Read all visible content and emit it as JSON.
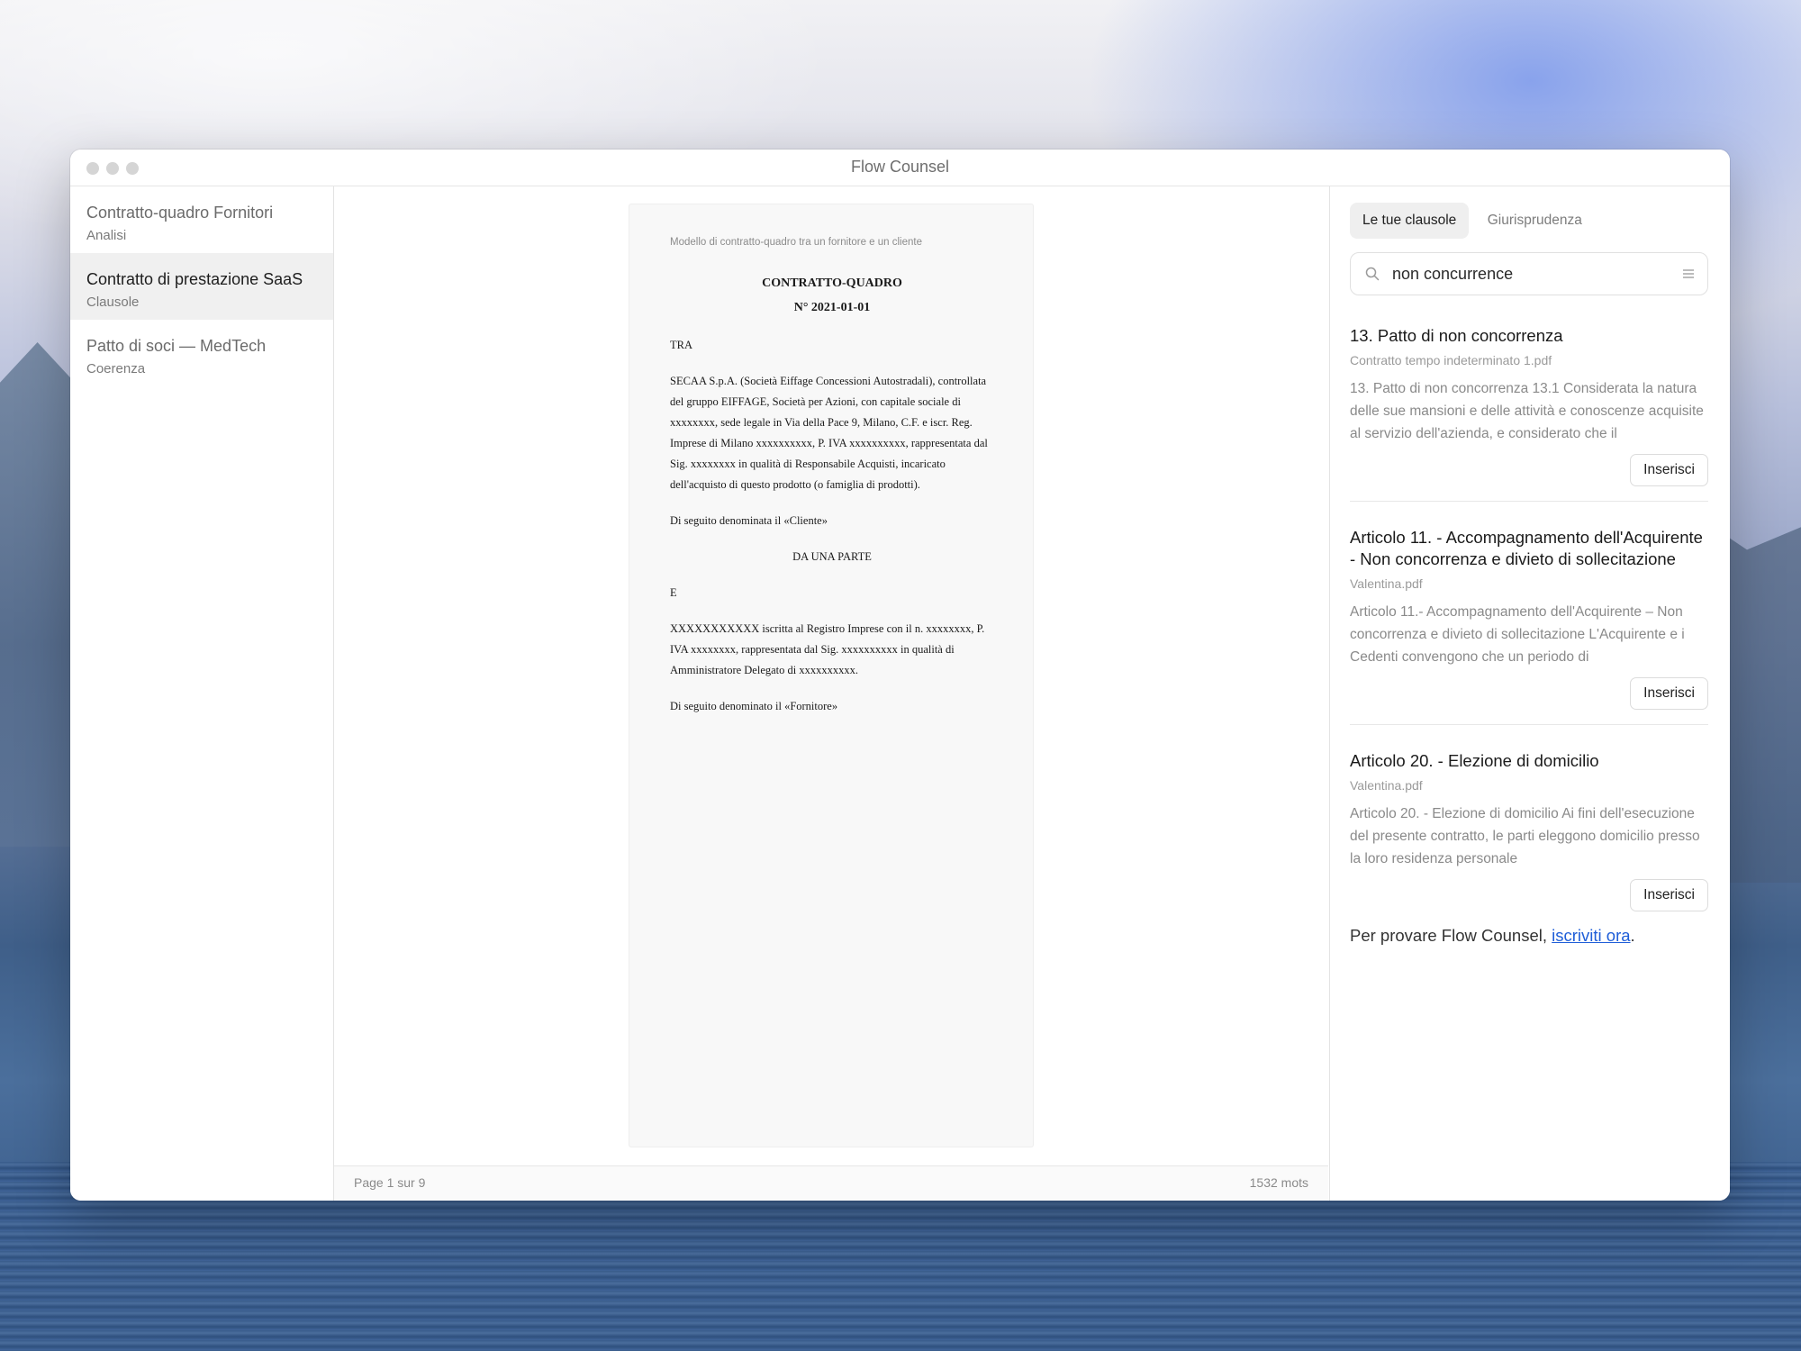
{
  "app": {
    "title": "Flow Counsel"
  },
  "sidebar": {
    "items": [
      {
        "title": "Contratto-quadro Fornitori",
        "subtitle": "Analisi",
        "active": false
      },
      {
        "title": "Contratto di prestazione SaaS",
        "subtitle": "Clausole",
        "active": true
      },
      {
        "title": "Patto di soci — MedTech",
        "subtitle": "Coerenza",
        "active": false
      }
    ]
  },
  "document": {
    "header_note": "Modello di contratto-quadro tra un fornitore e un cliente",
    "heading_line1": "CONTRATTO-QUADRO",
    "heading_line2": "N° 2021-01-01",
    "tra": "TRA",
    "party1": "SECAA S.p.A. (Società Eiffage Concessioni Autostradali), controllata del gruppo EIFFAGE, Società per Azioni, con capitale sociale di xxxxxxxx, sede legale in Via della Pace 9, Milano, C.F. e iscr. Reg. Imprese di Milano xxxxxxxxxx, P. IVA xxxxxxxxxx, rappresentata dal Sig. xxxxxxxx in qualità di Responsabile Acquisti, incaricato dell'acquisto di questo prodotto (o famiglia di prodotti).",
    "cliente": "Di seguito denominata il «Cliente»",
    "da_una_parte": "DA UNA PARTE",
    "e": "E",
    "party2": "XXXXXXXXXXX iscritta al Registro Imprese con il n. xxxxxxxx, P. IVA xxxxxxxx, rappresentata dal Sig. xxxxxxxxxx in qualità di Amministratore Delegato di xxxxxxxxxx.",
    "fornitore": "Di seguito denominato il «Fornitore»"
  },
  "statusbar": {
    "page": "Page 1 sur 9",
    "words": "1532 mots"
  },
  "panel": {
    "tabs": [
      {
        "label": "Le tue clausole",
        "active": true
      },
      {
        "label": "Giurisprudenza",
        "active": false
      }
    ],
    "search": {
      "value": "non concurrence",
      "icon": "search-icon",
      "filter_icon": "filter-lines-icon"
    },
    "results": [
      {
        "title": "13. Patto di non concorrenza",
        "file": "Contratto tempo indeterminato 1.pdf",
        "snippet": "13. Patto di non concorrenza 13.1 Considerata la natura delle sue mansioni e delle attività e conoscenze acquisite al servizio dell'azienda, e considerato che il",
        "button": "Inserisci"
      },
      {
        "title": "Articolo 11. - Accompagnamento dell'Acquirente - Non concorrenza e divieto di sollecitazione",
        "file": "Valentina.pdf",
        "snippet": "Articolo 11.- Accompagnamento dell'Acquirente – Non concorrenza e divieto di sollecitazione L'Acquirente e i Cedenti convengono che un periodo di",
        "button": "Inserisci"
      },
      {
        "title": "Articolo 20. - Elezione di domicilio",
        "file": "Valentina.pdf",
        "snippet": "Articolo 20. - Elezione di domicilio Ai fini dell'esecuzione del presente contratto, le parti eleggono domicilio presso la loro residenza personale",
        "button": "Inserisci"
      }
    ],
    "cta": {
      "prefix": "Per provare Flow Counsel, ",
      "link": "iscriviti ora",
      "suffix": "."
    }
  },
  "colors": {
    "link": "#1f5ed8",
    "active_bg": "#f0f0f0"
  }
}
